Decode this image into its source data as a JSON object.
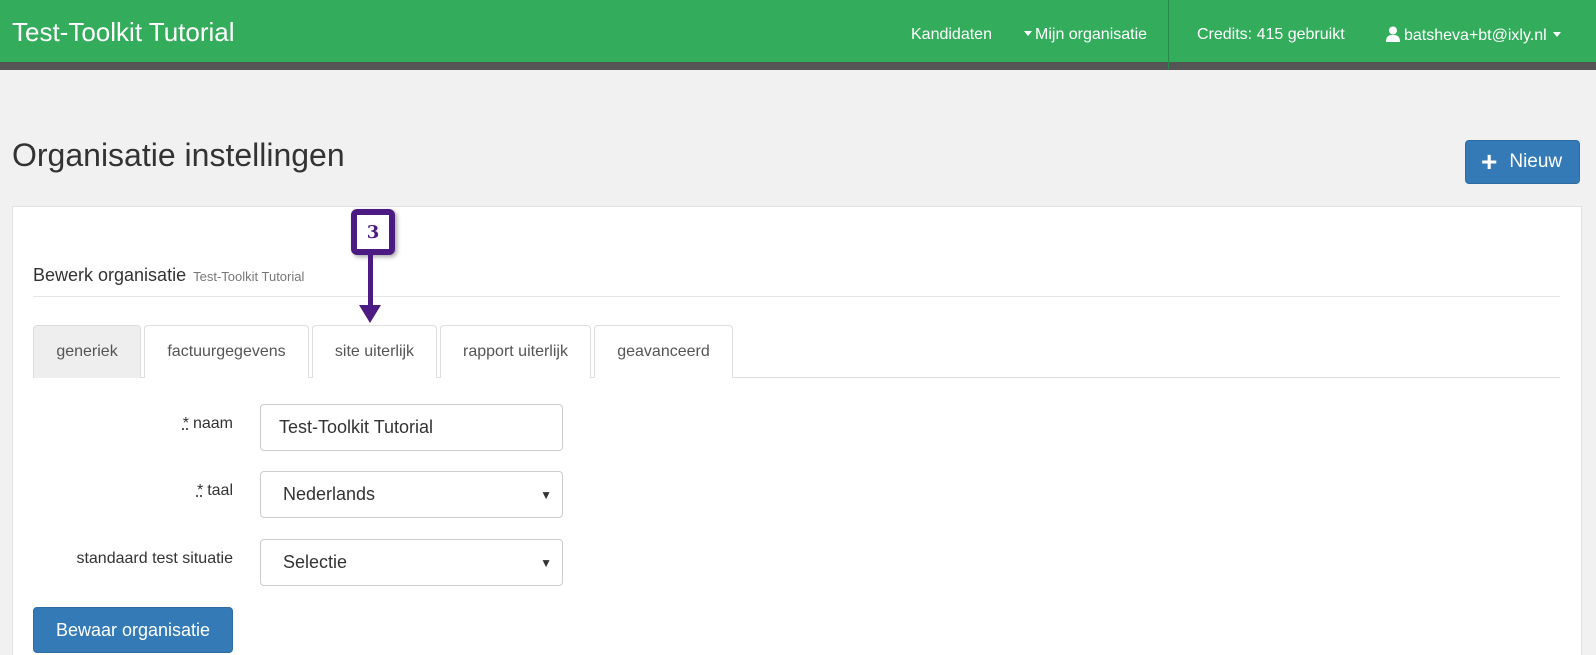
{
  "navbar": {
    "brand": "Test-Toolkit Tutorial",
    "kandidaten": "Kandidaten",
    "mijn_organisatie": "Mijn organisatie",
    "credits": "Credits: 415 gebruikt",
    "user_email": "batsheva+bt@ixly.nl",
    "bg_color": "#33ad5c"
  },
  "page": {
    "title": "Organisatie instellingen",
    "new_button": "Nieuw",
    "plus_icon": "+"
  },
  "form": {
    "heading": "Bewerk organisatie",
    "heading_sub": "Test-Toolkit Tutorial",
    "tabs": [
      {
        "label": "generiek"
      },
      {
        "label": "factuurgegevens"
      },
      {
        "label": "site uiterlijk"
      },
      {
        "label": "rapport uiterlijk"
      },
      {
        "label": "geavanceerd"
      }
    ],
    "required_mark": "*",
    "fields": {
      "naam_label": "naam",
      "naam_value": "Test-Toolkit Tutorial",
      "taal_label": "taal",
      "taal_value": "Nederlands",
      "situatie_label": "standaard test situatie",
      "situatie_value": "Selectie"
    },
    "save_button": "Bewaar organisatie"
  },
  "annotation": {
    "step_number": "3",
    "color": "#4b1a82"
  }
}
